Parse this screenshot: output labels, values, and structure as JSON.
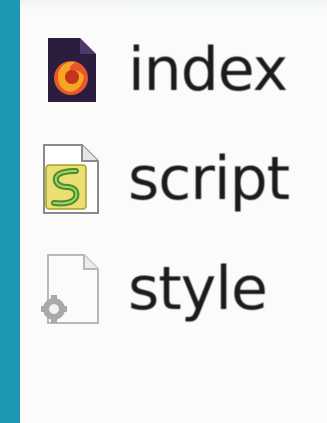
{
  "files": [
    {
      "name": "index",
      "icon": "firefox-html-document-icon"
    },
    {
      "name": "script",
      "icon": "javascript-file-icon"
    },
    {
      "name": "style",
      "icon": "css-file-icon"
    }
  ],
  "colors": {
    "background": "#1e98b2",
    "panel": "#fbfbfc",
    "text": "#1b1b1b"
  }
}
